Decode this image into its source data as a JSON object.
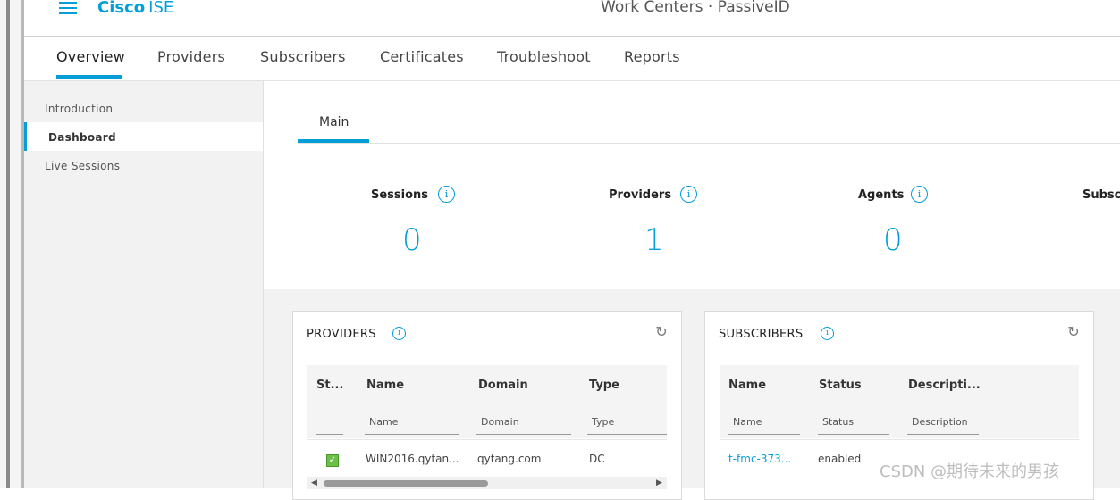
{
  "app": {
    "brand_bold": "Cisco",
    "brand_light": "ISE",
    "work_center_title": "Work Centers · PassiveID"
  },
  "tabs": [
    {
      "label": "Overview"
    },
    {
      "label": "Providers"
    },
    {
      "label": "Subscribers"
    },
    {
      "label": "Certificates"
    },
    {
      "label": "Troubleshoot"
    },
    {
      "label": "Reports"
    }
  ],
  "sidebar": {
    "items": [
      {
        "label": "Introduction"
      },
      {
        "label": "Dashboard"
      },
      {
        "label": "Live Sessions"
      }
    ]
  },
  "content": {
    "subtab": "Main",
    "stats": [
      {
        "label": "Sessions",
        "value": "0"
      },
      {
        "label": "Providers",
        "value": "1"
      },
      {
        "label": "Agents",
        "value": "0"
      },
      {
        "label": "Subsc"
      }
    ]
  },
  "providers_panel": {
    "title": "PROVIDERS",
    "headers": [
      "St...",
      "Name",
      "Domain",
      "Type"
    ],
    "filters": [
      "Name",
      "Domain",
      "Type"
    ],
    "rows": [
      {
        "name": "WIN2016.qytan...",
        "domain": "qytang.com",
        "type": "DC"
      }
    ]
  },
  "subscribers_panel": {
    "title": "SUBSCRIBERS",
    "headers": [
      "Name",
      "Status",
      "Descripti..."
    ],
    "filters": [
      "Name",
      "Status",
      "Description"
    ],
    "rows": [
      {
        "name": "t-fmc-373...",
        "status": "enabled"
      }
    ]
  },
  "watermark": "CSDN @期待未来的男孩",
  "colors": {
    "accent": "#049fd9",
    "success": "#6cc04a"
  }
}
